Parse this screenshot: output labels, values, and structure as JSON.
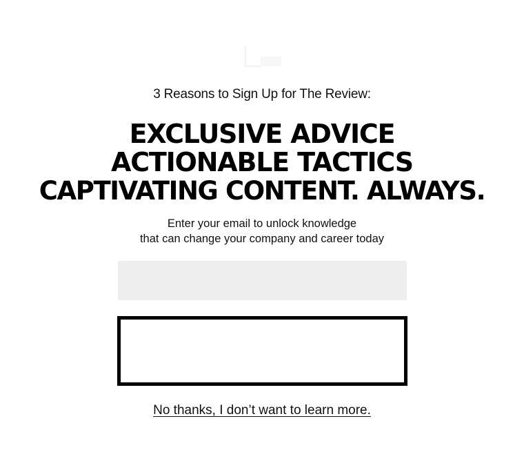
{
  "logo": {
    "alt": "brand-logo"
  },
  "popup": {
    "subtitle": "3 Reasons to Sign Up for The Review:",
    "headline": [
      "EXCLUSIVE ADVICE",
      "ACTIONABLE TACTICS",
      "CAPTIVATING CONTENT. ALWAYS."
    ],
    "description": [
      "Enter your email to unlock knowledge",
      "that can change your company and career today"
    ],
    "email_value": "",
    "submit_label": "",
    "decline_link": "No thanks, I don’t want to learn more."
  },
  "colors": {
    "background": "#ffffff",
    "text": "#000000",
    "input_background": "#eeeeee",
    "button_border": "#000000"
  },
  "icons": {
    "logo": "brand-logo-icon"
  }
}
